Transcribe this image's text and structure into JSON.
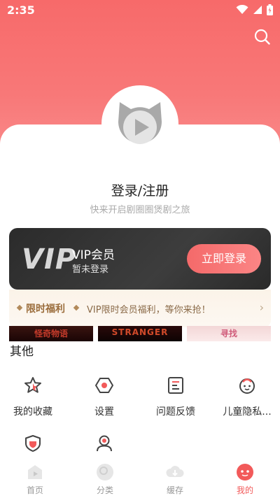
{
  "status_bar": {
    "time": "2:35"
  },
  "profile": {
    "login_title": "登录/注册",
    "login_subtitle": "快来开启剧圈圈煲剧之旅"
  },
  "vip": {
    "logo": "VIP",
    "name": "VIP会员",
    "status": "暂未登录",
    "login_button": "立即登录"
  },
  "promo": {
    "tag": "限时福利",
    "text": "VIP限时会员福利，等你来抢！",
    "arrow": "›"
  },
  "banners": [
    "怪奇物语",
    "STRANGER",
    "寻找"
  ],
  "other": {
    "title": "其他",
    "items": [
      {
        "label": "我的收藏",
        "icon": "star-icon"
      },
      {
        "label": "设置",
        "icon": "settings-icon"
      },
      {
        "label": "问题反馈",
        "icon": "feedback-icon"
      },
      {
        "label": "儿童隐私...",
        "icon": "child-privacy-icon"
      },
      {
        "label": "",
        "icon": "shield-icon"
      },
      {
        "label": "",
        "icon": "person-icon"
      }
    ]
  },
  "tabbar": {
    "items": [
      {
        "label": "首页",
        "icon": "home-icon",
        "active": false
      },
      {
        "label": "分类",
        "icon": "category-icon",
        "active": false
      },
      {
        "label": "缓存",
        "icon": "download-icon",
        "active": false
      },
      {
        "label": "我的",
        "icon": "mine-icon",
        "active": true
      }
    ]
  },
  "colors": {
    "accent": "#f25a5a",
    "header": "#f76a6a",
    "vip_card": "#2b2b2b",
    "promo_text": "#9b6d3c"
  }
}
